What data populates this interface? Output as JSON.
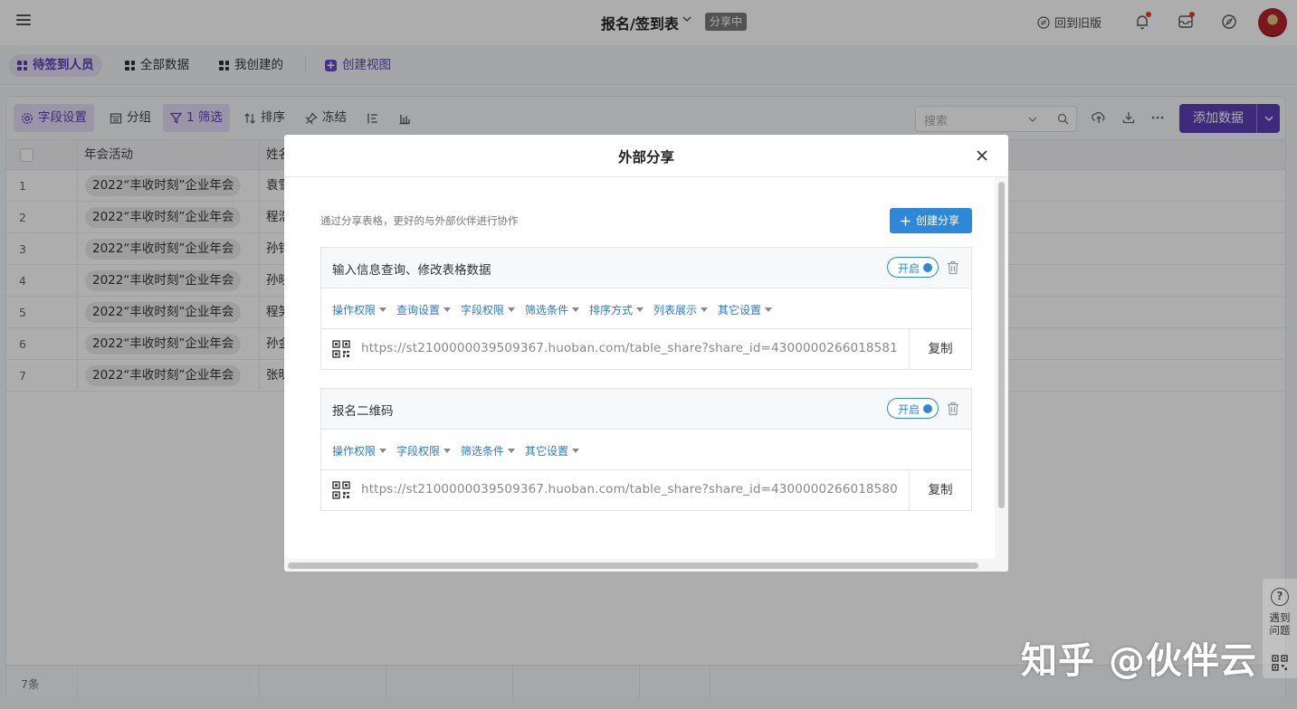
{
  "topbar": {
    "title": "报名/签到表",
    "share_badge": "分享中",
    "old_version": "回到旧版"
  },
  "views": {
    "items": [
      "待签到人员",
      "全部数据",
      "我创建的"
    ],
    "create": "创建视图"
  },
  "toolbar": {
    "field_settings": "字段设置",
    "group": "分组",
    "filter": "1 筛选",
    "sort": "排序",
    "freeze": "冻结",
    "search_placeholder": "搜索",
    "add_data": "添加数据"
  },
  "table": {
    "columns": [
      "年会活动",
      "姓名"
    ],
    "rows": [
      {
        "num": "1",
        "event": "2022“丰收时刻”企业年会",
        "name": "袁雪"
      },
      {
        "num": "2",
        "event": "2022“丰收时刻”企业年会",
        "name": "程浩"
      },
      {
        "num": "3",
        "event": "2022“丰收时刻”企业年会",
        "name": "孙铭"
      },
      {
        "num": "4",
        "event": "2022“丰收时刻”企业年会",
        "name": "孙晓"
      },
      {
        "num": "5",
        "event": "2022“丰收时刻”企业年会",
        "name": "程笑"
      },
      {
        "num": "6",
        "event": "2022“丰收时刻”企业年会",
        "name": "孙金"
      },
      {
        "num": "7",
        "event": "2022“丰收时刻”企业年会",
        "name": "张明"
      }
    ],
    "footer_count": "7条"
  },
  "modal": {
    "title": "外部分享",
    "description": "通过分享表格，更好的与外部伙伴进行协作",
    "create_share": "创建分享",
    "shares": [
      {
        "title": "输入信息查询、修改表格数据",
        "toggle": "开启",
        "options": [
          "操作权限",
          "查询设置",
          "字段权限",
          "筛选条件",
          "排序方式",
          "列表展示",
          "其它设置"
        ],
        "url": "https://st2100000039509367.huoban.com/table_share?share_id=4300000266018581",
        "copy": "复制"
      },
      {
        "title": "报名二维码",
        "toggle": "开启",
        "options": [
          "操作权限",
          "字段权限",
          "筛选条件",
          "其它设置"
        ],
        "url": "https://st2100000039509367.huoban.com/table_share?share_id=4300000266018580",
        "copy": "复制"
      }
    ]
  },
  "help": {
    "text": "遇到问题"
  },
  "watermark": "知乎 @伙伴云",
  "colors": {
    "brand_purple": "#5b3fb5",
    "share_blue": "#2e88d8",
    "notification_red": "#e53935"
  }
}
